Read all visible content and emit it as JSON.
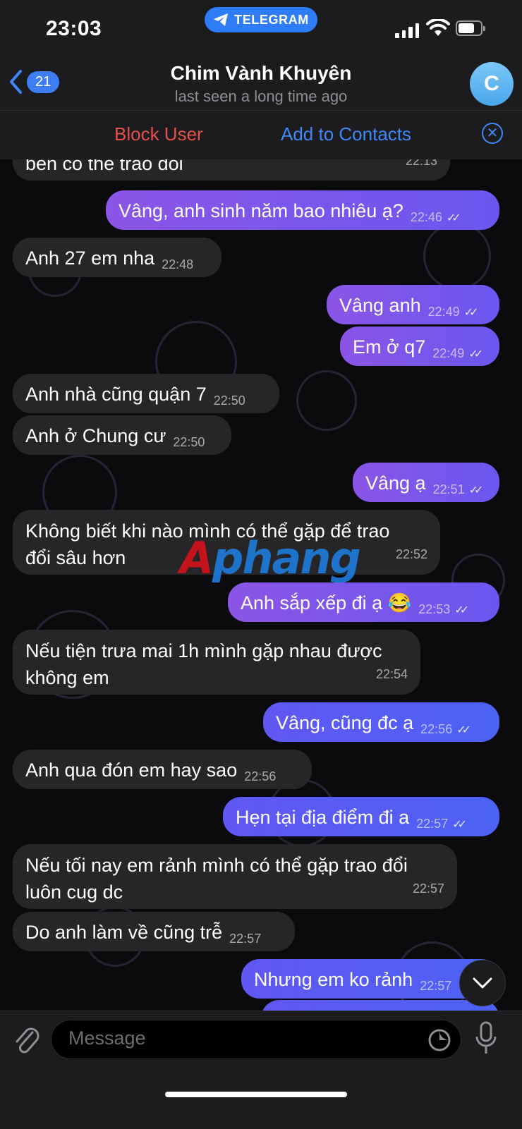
{
  "status": {
    "time": "23:03",
    "app_pill": "TELEGRAM"
  },
  "header": {
    "back_count": "21",
    "title": "Chim Vành Khuyên",
    "subtitle": "last seen a long time ago",
    "avatar_letter": "C"
  },
  "actions": {
    "block": "Block User",
    "add": "Add to Contacts"
  },
  "messages": [
    {
      "dir": "in",
      "text": "bên có thể trao đổi",
      "time": "22:13"
    },
    {
      "dir": "out",
      "text": "Vâng, anh sinh năm bao nhiêu ạ?",
      "time": "22:46"
    },
    {
      "dir": "in",
      "text": "Anh 27 em nha",
      "time": "22:48"
    },
    {
      "dir": "out",
      "text": "Vâng anh",
      "time": "22:49"
    },
    {
      "dir": "out",
      "text": "Em ở q7",
      "time": "22:49"
    },
    {
      "dir": "in",
      "text": "Anh nhà cũng quận 7",
      "time": "22:50"
    },
    {
      "dir": "in",
      "text": "Anh ở Chung cư",
      "time": "22:50"
    },
    {
      "dir": "out",
      "text": "Vâng ạ",
      "time": "22:51"
    },
    {
      "dir": "in",
      "line1": "Không biết khi nào mình có thể gặp để trao",
      "line2": "đổi sâu hơn",
      "time": "22:52"
    },
    {
      "dir": "out",
      "text": "Anh sắp xếp đi ạ 😂",
      "time": "22:53"
    },
    {
      "dir": "in",
      "line1": "Nếu tiện trưa mai 1h mình gặp nhau được",
      "line2": "không em",
      "time": "22:54"
    },
    {
      "dir": "out",
      "text": "Vâng, cũng đc ạ",
      "time": "22:56"
    },
    {
      "dir": "in",
      "text": "Anh qua đón em hay sao",
      "time": "22:56"
    },
    {
      "dir": "out",
      "text": "Hẹn tại địa điểm đi a",
      "time": "22:57"
    },
    {
      "dir": "in",
      "line1": "Nếu tối nay em rảnh mình có thể gặp trao đổi",
      "line2": "luôn cug dc",
      "time": "22:57"
    },
    {
      "dir": "in",
      "text": "Do anh làm về cũng trễ",
      "time": "22:57"
    },
    {
      "dir": "out",
      "text": "Nhưng em ko rảnh",
      "time": "22:57"
    }
  ],
  "watermark": {
    "a": "A",
    "rest": "phang"
  },
  "input": {
    "placeholder": "Message"
  },
  "icons": {
    "attach": "paperclip-icon",
    "sticker": "sticker-icon",
    "mic": "microphone-icon",
    "scroll": "chevron-down-icon"
  }
}
